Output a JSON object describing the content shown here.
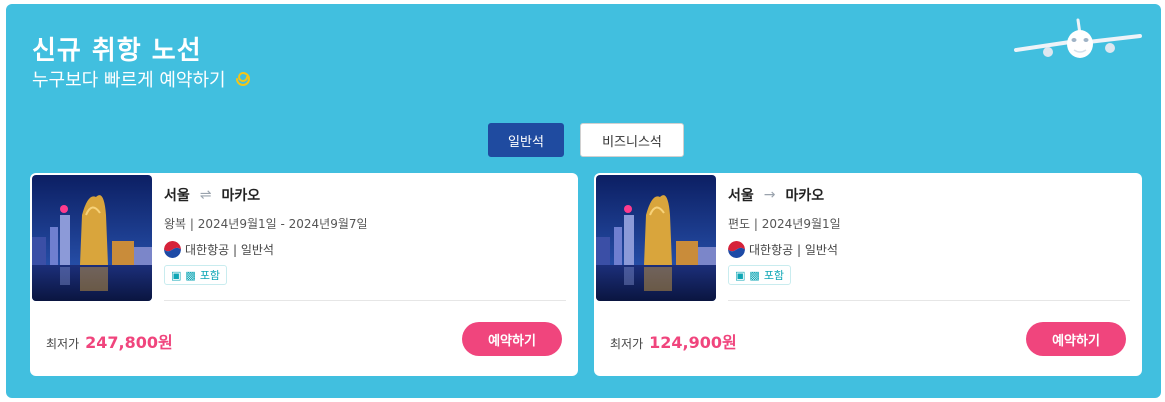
{
  "header": {
    "title": "신규 취항 노선",
    "subtitle": "누구보다 빠르게 예약하기",
    "subtitle_icon": "swirl-icon"
  },
  "tabs": [
    {
      "label": "일반석",
      "active": true
    },
    {
      "label": "비즈니스석",
      "active": false
    }
  ],
  "cards": [
    {
      "from": "서울",
      "to": "마카오",
      "trip_icon": "round-trip-arrows-icon",
      "dates": "왕복 | 2024년9월1일 - 2024년9월7일",
      "airline": "대한항공 | 일반석",
      "baggage": "포함",
      "price_label": "최저가",
      "price": "247,800원",
      "button": "예약하기"
    },
    {
      "from": "서울",
      "to": "마카오",
      "trip_icon": "one-way-arrow-icon",
      "dates": "편도 | 2024년9월1일",
      "airline": "대한항공 | 일반석",
      "baggage": "포함",
      "price_label": "최저가",
      "price": "124,900원",
      "button": "예약하기"
    }
  ],
  "colors": {
    "panel": "#41bfdf",
    "active_tab": "#1f4ba0",
    "price": "#f0457d",
    "button": "#f0457d"
  }
}
